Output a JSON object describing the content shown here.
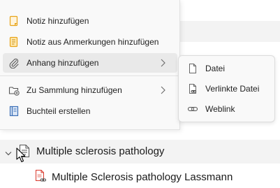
{
  "context_menu": {
    "items": [
      {
        "label": "Notiz hinzufügen",
        "icon": "note-add-icon"
      },
      {
        "label": "Notiz aus Anmerkungen hinzufügen",
        "icon": "note-from-annotations-icon"
      },
      {
        "label": "Anhang hinzufügen",
        "icon": "paperclip-icon",
        "has_submenu": true
      },
      {
        "label": "Zu Sammlung hinzufügen",
        "icon": "collection-add-icon",
        "has_submenu": true
      },
      {
        "label": "Buchteil erstellen",
        "icon": "book-section-icon"
      }
    ]
  },
  "submenu": {
    "items": [
      {
        "label": "Datei",
        "icon": "file-icon"
      },
      {
        "label": "Verlinkte Datei",
        "icon": "linked-file-icon"
      },
      {
        "label": "Weblink",
        "icon": "link-icon"
      }
    ]
  },
  "tree": {
    "parent_item": {
      "title": "Multiple sclerosis pathology",
      "icon": "document-icon"
    },
    "child_item": {
      "title": "Multiple Sclerosis pathology Lassmann",
      "icon": "linked-pdf-icon"
    }
  },
  "colors": {
    "menu_background": "#f9f9f9",
    "hover_background": "#e9e9e9",
    "note_icon": "#e8a317",
    "book_icon": "#3b6fb6",
    "pdf_icon": "#d9372b"
  }
}
